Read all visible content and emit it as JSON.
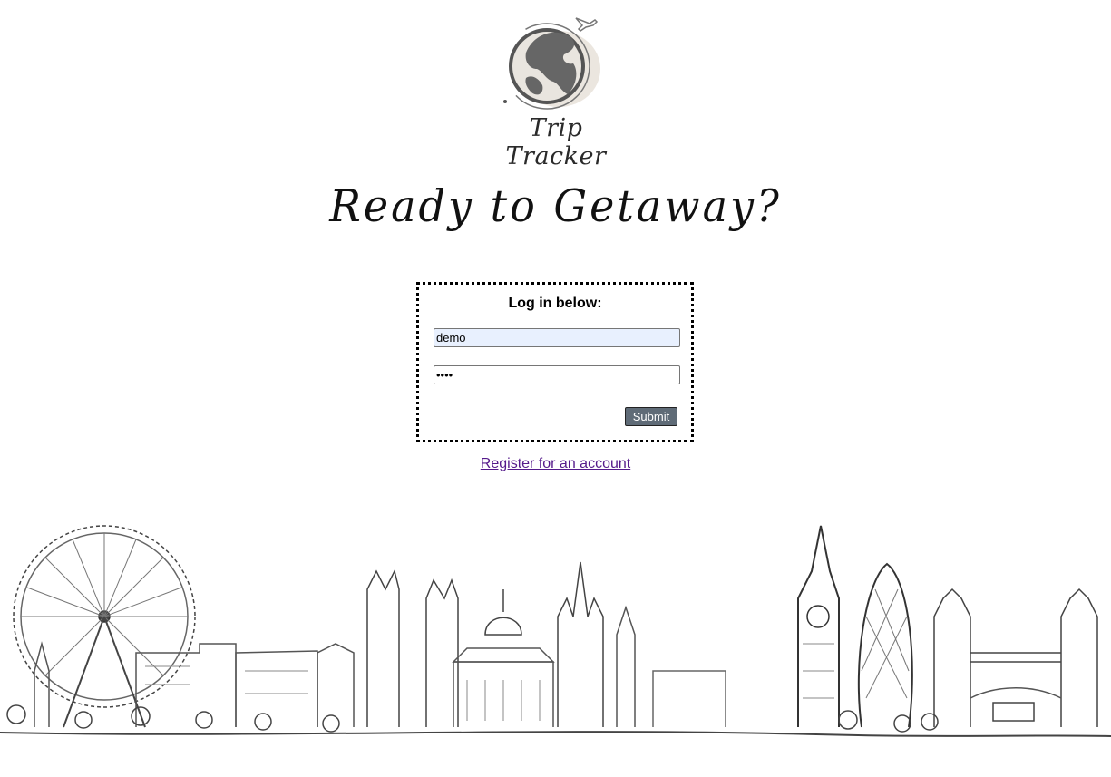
{
  "brand": {
    "name": "Trip Tracker",
    "logo_icon": "globe-with-airplane-icon"
  },
  "headline": "Ready to Getaway?",
  "login": {
    "title": "Log in below:",
    "username_value": "demo",
    "password_value": "demo",
    "submit_label": "Submit"
  },
  "register": {
    "link_text": "Register for an account"
  },
  "illustration": {
    "name": "london-skyline-sketch"
  },
  "colors": {
    "link": "#551a8b",
    "submit_bg": "#5f6b77",
    "autofill_bg": "#e8f0fe"
  }
}
